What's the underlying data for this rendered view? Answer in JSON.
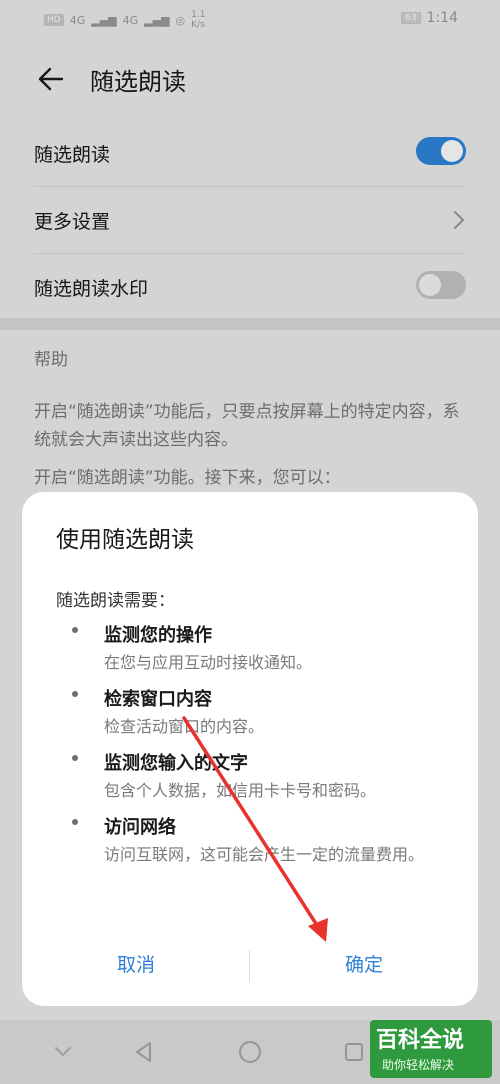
{
  "status_bar": {
    "hd_badge": "HD",
    "network_1": "4G",
    "network_2": "4G",
    "speed": "1.1\nK/s",
    "battery": "63",
    "time": "1:14"
  },
  "header": {
    "title": "随选朗读"
  },
  "settings": {
    "items": [
      {
        "label": "随选朗读",
        "control": "toggle",
        "on": true
      },
      {
        "label": "更多设置",
        "control": "chevron"
      },
      {
        "label": "随选朗读水印",
        "control": "toggle",
        "on": false
      }
    ]
  },
  "help": {
    "title": "帮助",
    "paragraphs": [
      "开启“随选朗读”功能后，只要点按屏幕上的特定内容，系统就会大声读出这些内容。",
      "开启“随选朗读”功能。接下来，您可以："
    ]
  },
  "dialog": {
    "title": "使用随选朗读",
    "intro": "随选朗读需要：",
    "permissions": [
      {
        "title": "监测您的操作",
        "desc": "在您与应用互动时接收通知。"
      },
      {
        "title": "检索窗口内容",
        "desc": "检查活动窗口的内容。"
      },
      {
        "title": "监测您输入的文字",
        "desc": "包含个人数据，如信用卡卡号和密码。"
      },
      {
        "title": "访问网络",
        "desc": "访问互联网，这可能会产生一定的流量费用。"
      }
    ],
    "cancel_label": "取消",
    "ok_label": "确定"
  },
  "watermark": {
    "main": "百科全说",
    "sub": "助你轻松解决"
  },
  "colors": {
    "accent": "#2f86dc",
    "button_text": "#2f7fd8",
    "annotation_arrow": "#e8322a",
    "watermark_bg": "#2f9a3d"
  }
}
